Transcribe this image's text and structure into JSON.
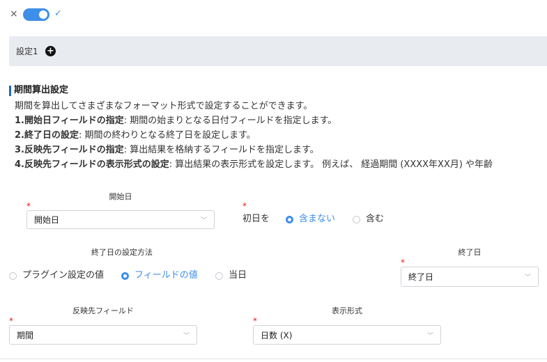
{
  "topbar": {
    "close_glyph": "×",
    "check_glyph": "✓"
  },
  "tabs": {
    "setting_label": "設定1",
    "add_glyph": "+"
  },
  "description": {
    "title": "期間算出設定",
    "intro": "期間を算出してさまざまなフォーマット形式で設定することができます。",
    "items": [
      {
        "label": "1.開始日フィールドの指定",
        "text": ": 期間の始まりとなる日付フィールドを指定します。"
      },
      {
        "label": "2.終了日の設定",
        "text": ": 期間の終わりとなる終了日を設定します。"
      },
      {
        "label": "3.反映先フィールドの指定",
        "text": ": 算出結果を格納するフィールドを指定します。"
      },
      {
        "label": "4.反映先フィールドの表示形式の設定",
        "text": ": 算出結果の表示形式を設定します。 例えば、 経過期間 (XXXX年XX月) や年齢"
      }
    ]
  },
  "form": {
    "required_mark": "*",
    "start_date": {
      "label": "開始日",
      "value": "開始日"
    },
    "first_day": {
      "label": "初日を",
      "options": [
        "含まない",
        "含む"
      ],
      "selected": "含まない"
    },
    "end_method": {
      "label": "終了日の設定方法",
      "options": [
        "プラグイン設定の値",
        "フィールドの値",
        "当日"
      ],
      "selected": "フィールドの値"
    },
    "end_date": {
      "label": "終了日",
      "value": "終了日"
    },
    "target_field": {
      "label": "反映先フィールド",
      "value": "期間"
    },
    "display_format": {
      "label": "表示形式",
      "value": "日数 (X)"
    },
    "chevron_glyph": "﹀"
  },
  "colors": {
    "accent": "#3f8ee8",
    "required": "#e21b1b",
    "tabbar": "#e8ebf0",
    "title_bar": "#1a66c9"
  }
}
